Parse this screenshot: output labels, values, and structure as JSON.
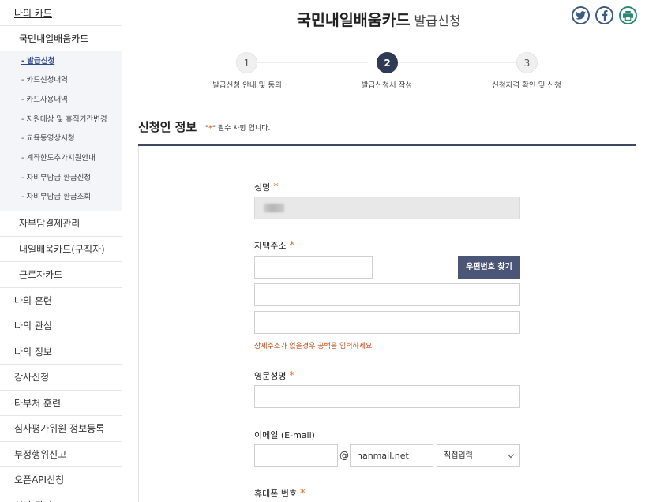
{
  "sidebar": {
    "top_label": "나의 카드",
    "sub_label": "국민내일배움카드",
    "nested": [
      "- 발급신청",
      "- 카드신청내역",
      "- 카드사용내역",
      "- 지원대상 및 휴직기간변경",
      "- 교육동영상시청",
      "- 계좌한도추가지원안내",
      "- 자비부담금 환급신청",
      "- 자비부담금 환급조회"
    ],
    "lvl2": [
      "자부담결제관리",
      "내일배움카드(구직자)",
      "근로자카드"
    ],
    "main": [
      "나의 훈련",
      "나의 관심",
      "나의 정보",
      "강사신청",
      "타부처 훈련",
      "심사평가위원 정보등록",
      "부정행위신고",
      "오픈API신청",
      "심사 관리"
    ]
  },
  "header": {
    "title": "국민내일배움카드",
    "subtitle": "발급신청"
  },
  "share_icons": [
    "twitter-icon",
    "facebook-icon",
    "print-icon"
  ],
  "steps": [
    {
      "num": "1",
      "label": "발급신청 안내 및 동의"
    },
    {
      "num": "2",
      "label": "발급신청서 작성"
    },
    {
      "num": "3",
      "label": "신청자격 확인 및 신청"
    }
  ],
  "section": {
    "title": "신청인 정보",
    "note_open": "\"",
    "note_star": "*",
    "note_rest": "\" 필수 사항 입니다."
  },
  "form": {
    "name_label": "성명",
    "address_label": "자택주소",
    "postcode_button": "우편번호 찾기",
    "address_warning": "상세주소가 없을경우 공백을 입력하세요",
    "eng_name_label": "영문성명",
    "email_label": "이메일 (E-mail)",
    "email_at": "@",
    "email_domain": "hanmail.net",
    "email_select": "직접입력",
    "phone_label": "휴대폰 번호",
    "required_mark": "*"
  },
  "colors": {
    "accent": "#2f3a55",
    "required": "#e36c2c",
    "button": "#4b5575"
  }
}
